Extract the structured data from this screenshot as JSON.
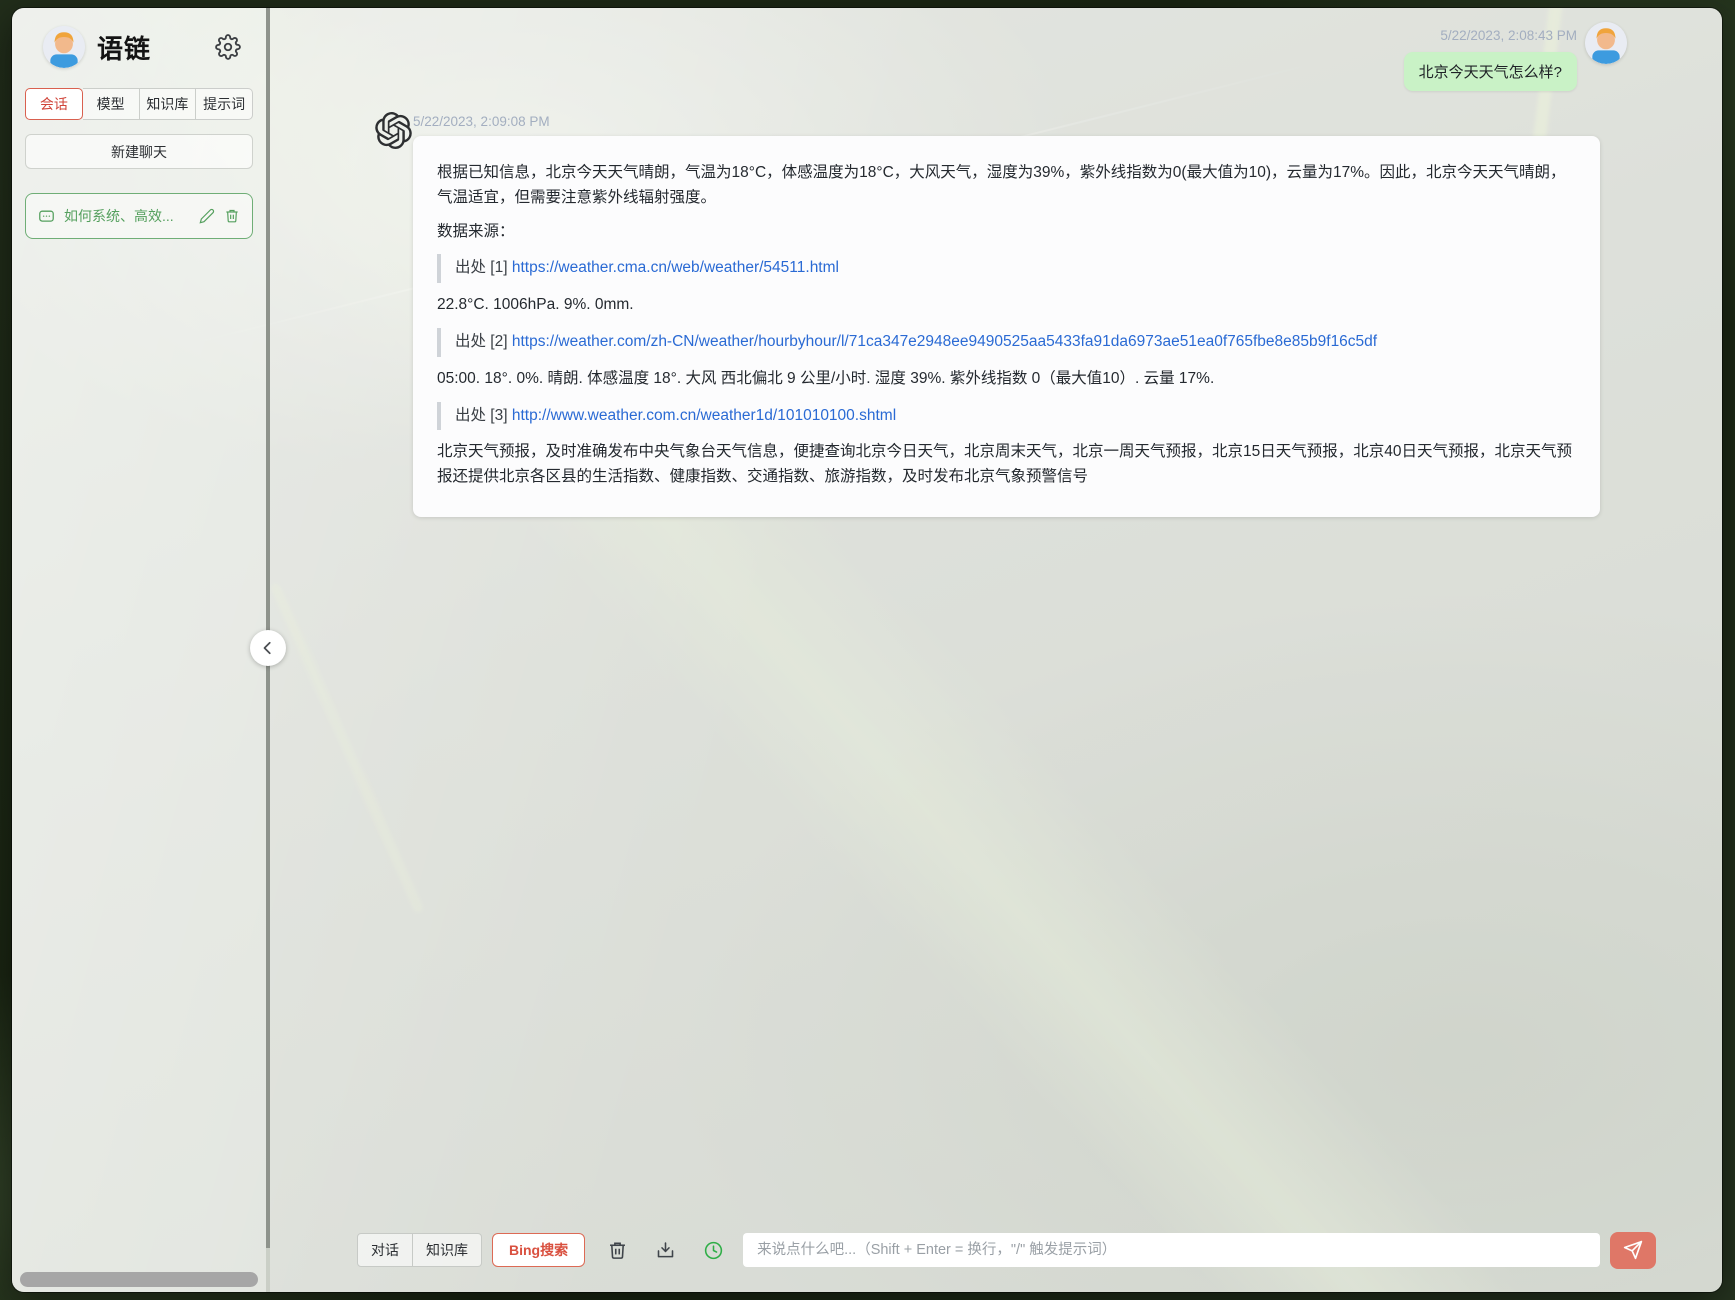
{
  "app": {
    "title": "语链"
  },
  "sidebar": {
    "title": "语链",
    "tabs": [
      {
        "label": "会话",
        "active": true
      },
      {
        "label": "模型",
        "active": false
      },
      {
        "label": "知识库",
        "active": false
      },
      {
        "label": "提示词",
        "active": false
      }
    ],
    "new_chat_label": "新建聊天",
    "conversations": [
      {
        "title": "如何系统、高效..."
      }
    ]
  },
  "chat": {
    "user_message": {
      "timestamp": "5/22/2023, 2:08:43 PM",
      "text": "北京今天天气怎么样?"
    },
    "assistant_message": {
      "timestamp": "5/22/2023, 2:09:08 PM",
      "intro": "根据已知信息，北京今天天气晴朗，气温为18°C，体感温度为18°C，大风天气，湿度为39%，紫外线指数为0(最大值为10)，云量为17%。因此，北京今天天气晴朗，气温适宜，但需要注意紫外线辐射强度。",
      "sources_label": "数据来源：",
      "citations": [
        {
          "label": "出处 [1]",
          "url": "https://weather.cma.cn/web/weather/54511.html",
          "snippet": "22.8°C. 1006hPa. 9%. 0mm."
        },
        {
          "label": "出处 [2]",
          "url": "https://weather.com/zh-CN/weather/hourbyhour/l/71ca347e2948ee9490525aa5433fa91da6973ae51ea0f765fbe8e85b9f16c5df",
          "snippet": "05:00. 18°. 0%. 晴朗. 体感温度 18°. 大风 西北偏北 9 公里/小时. 湿度 39%. 紫外线指数 0（最大值10）. 云量 17%."
        },
        {
          "label": "出处 [3]",
          "url": "http://www.weather.com.cn/weather1d/101010100.shtml",
          "snippet": "北京天气预报，及时准确发布中央气象台天气信息，便捷查询北京今日天气，北京周末天气，北京一周天气预报，北京15日天气预报，北京40日天气预报，北京天气预报还提供北京各区县的生活指数、健康指数、交通指数、旅游指数，及时发布北京气象预警信号"
        }
      ]
    }
  },
  "composer": {
    "mode_tabs": [
      {
        "label": "对话",
        "active": false
      },
      {
        "label": "知识库",
        "active": false
      },
      {
        "label": "Bing搜索",
        "active": true
      }
    ],
    "placeholder": "来说点什么吧...（Shift + Enter = 换行，\"/\" 触发提示词）"
  },
  "icons": {
    "gear": "settings gear",
    "chat_bubble": "conversation bubble",
    "edit": "pencil",
    "trash": "trash bin",
    "download": "download tray",
    "history": "green clock",
    "send": "paper plane",
    "chevron_left": "collapse sidebar",
    "openai": "assistant logo knot"
  },
  "colors": {
    "accent_red": "#d9503f",
    "send_button": "#df7767",
    "green_accent": "#5faf68",
    "user_bubble": "#c9f2c6",
    "link": "#2a6ad4"
  }
}
